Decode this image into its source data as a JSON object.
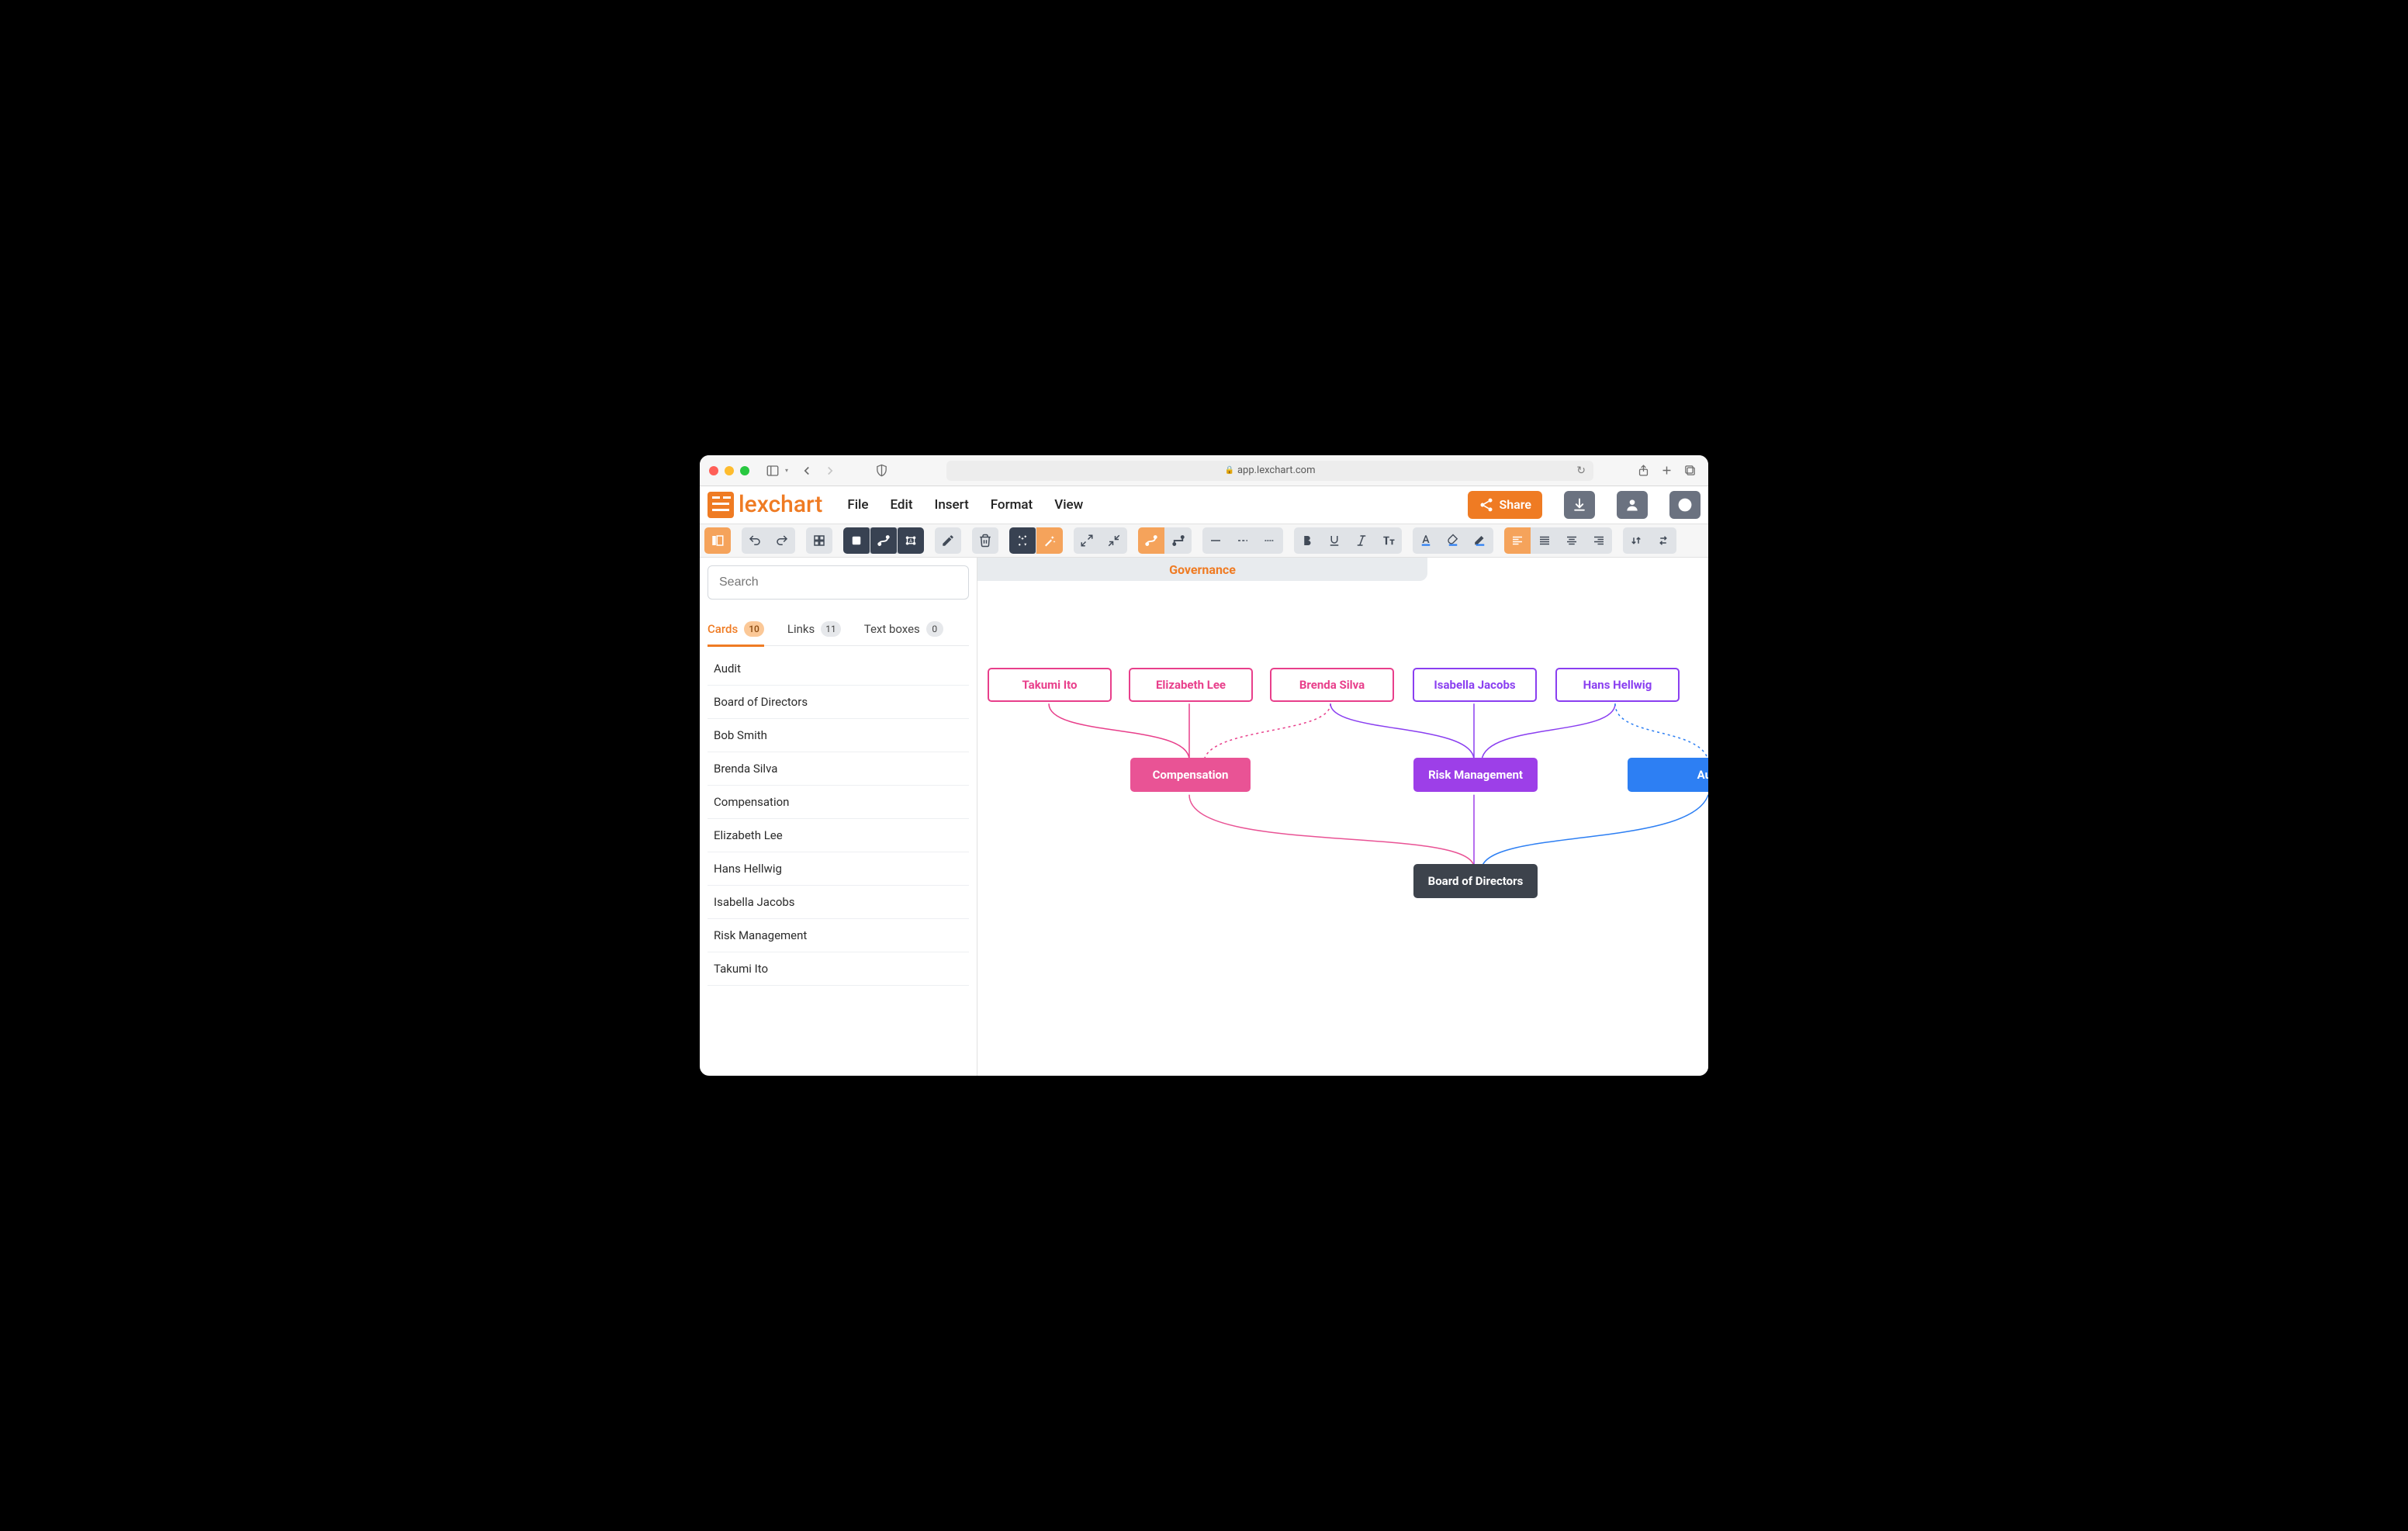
{
  "browser": {
    "url": "app.lexchart.com"
  },
  "app": {
    "logo_text": "lexchart",
    "menus": {
      "file": "File",
      "edit": "Edit",
      "insert": "Insert",
      "format": "Format",
      "view": "View"
    },
    "share": "Share"
  },
  "sidebar": {
    "search_placeholder": "Search",
    "tabs": {
      "cards": {
        "label": "Cards",
        "count": "10"
      },
      "links": {
        "label": "Links",
        "count": "11"
      },
      "textboxes": {
        "label": "Text boxes",
        "count": "0"
      }
    },
    "cards": [
      "Audit",
      "Board of Directors",
      "Bob Smith",
      "Brenda Silva",
      "Compensation",
      "Elizabeth Lee",
      "Hans Hellwig",
      "Isabella Jacobs",
      "Risk Management",
      "Takumi Ito"
    ]
  },
  "canvas": {
    "doc_title": "Governance",
    "nodes": {
      "takumi": "Takumi Ito",
      "elizabeth": "Elizabeth Lee",
      "brenda": "Brenda Silva",
      "isabella": "Isabella Jacobs",
      "hans": "Hans Hellwig",
      "compensation": "Compensation",
      "risk": "Risk Management",
      "audit": "Au",
      "board": "Board of Directors"
    }
  },
  "colors": {
    "accent": "#ef7b23",
    "pink": "#e95395",
    "purple": "#9d3fe8",
    "blue": "#2d7ff3",
    "dark": "#3d434c"
  }
}
